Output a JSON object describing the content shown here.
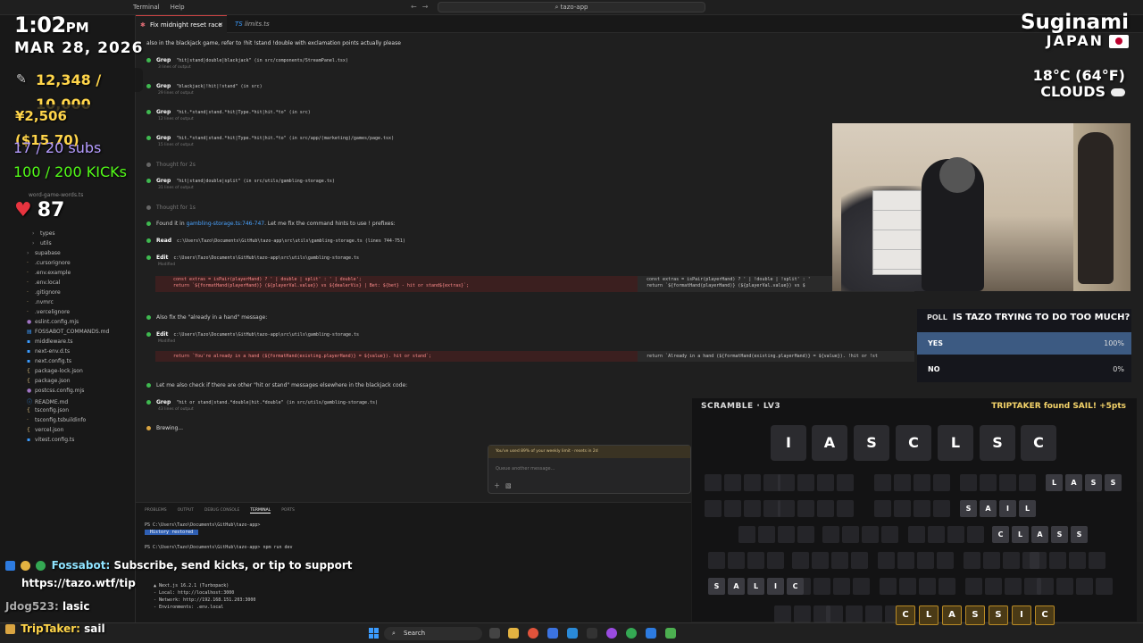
{
  "window": {
    "menu": [
      "Terminal",
      "Help"
    ],
    "search_text": "tazo-app"
  },
  "tabs": [
    {
      "label": "Fix midnight reset race ...",
      "active": true
    },
    {
      "label": "limits.ts",
      "active": false
    }
  ],
  "sidebar": {
    "items": [
      "types",
      "utils",
      "supabase",
      ".cursorignore",
      ".env.example",
      ".env.local",
      ".gitignore",
      ".nvmrc",
      ".vercelignore",
      "eslint.config.mjs",
      "FOSSABOT_COMMANDS.md",
      "middleware.ts",
      "next-env.d.ts",
      "next.config.ts",
      "package-lock.json",
      "package.json",
      "postcss.config.mjs",
      "README.md",
      "tsconfig.json",
      "tsconfig.tsbuildinfo",
      "vercel.json",
      "vitest.config.ts"
    ],
    "partial": "word-game-words.ts"
  },
  "chat": {
    "prompt": "also in the blackjack game, refer to !hit !stand !double with exclamation points actually please",
    "steps": [
      {
        "kw": "Grep",
        "cmd": "\"hit|stand|double|blackjack\"  (in src/components/StreamPanel.tsx)",
        "sub": "3 lines of output"
      },
      {
        "kw": "Grep",
        "cmd": "\"blackjack|!hit|!stand\"  (in src)",
        "sub": "29 lines of output"
      },
      {
        "kw": "Grep",
        "cmd": "\"hit.*stand|stand.*hit|Type.*hit|hit.*to\"  (in src)",
        "sub": "12 lines of output"
      },
      {
        "kw": "Grep",
        "cmd": "\"hit.*stand|stand.*hit|Type.*hit|hit.*to\"  (in src/app/(marketing)/games/page.tsx)",
        "sub": "15 lines of output"
      },
      {
        "kw": "",
        "cmd": "Thought for 2s",
        "sub": ""
      },
      {
        "kw": "Grep",
        "cmd": "\"hit|stand|double|split\"  (in src/utils/gambling-storage.ts)",
        "sub": "31 lines of output"
      },
      {
        "kw": "",
        "cmd": "Thought for 1s",
        "sub": ""
      }
    ],
    "found_text": "Found it in",
    "found_link": "gambling-storage.ts:746-747",
    "found_rest": ". Let me fix the command hints to use  !  prefixes:",
    "read": {
      "kw": "Read",
      "cmd": "c:\\Users\\Tazo\\Documents\\GitHub\\tazo-app\\src\\utils\\gambling-storage.ts (lines 744-751)"
    },
    "edit1": {
      "kw": "Edit",
      "cmd": "c:\\Users\\Tazo\\Documents\\GitHub\\tazo-app\\src\\utils\\gambling-storage.ts",
      "sub": "Modified"
    },
    "diff1": {
      "l1": "const extras = isPair(playerHand) ? ' | double | split' : ' | double';",
      "l2": "return `${formatHand(playerHand)} (${playerVal.value}) vs ${dealerVis} | Bet: ${bet} - hit or stand${extras}`;",
      "r1": "const extras = isPair(playerHand) ? ' | !double | !split' : '",
      "r2": "return `${formatHand(playerHand)} (${playerVal.value}) vs $"
    },
    "also_fix": "Also fix the \"already in a hand\" message:",
    "edit2": {
      "kw": "Edit",
      "cmd": "c:\\Users\\Tazo\\Documents\\GitHub\\tazo-app\\src\\utils\\gambling-storage.ts",
      "sub": "Modified"
    },
    "diff2": {
      "l1": "return `You're already in a hand (${formatHand(existing.playerHand)} = ${value}). hit or stand`;",
      "r1": "return `Already in a hand (${formatHand(existing.playerHand)} = ${value}). !hit or !st"
    },
    "check_text": "Let me also check if there are other \"hit or stand\" messages elsewhere in the blackjack code:",
    "grep_last": {
      "kw": "Grep",
      "cmd": "\"hit or stand|stand.*double|hit.*double\"  (in src/utils/gambling-storage.ts)",
      "sub": "43 lines of output"
    },
    "brewing": "Brewing..."
  },
  "input": {
    "warning": "You've used 89% of your weekly limit · resets in 2d",
    "placeholder": "Queue another message..."
  },
  "terminal": {
    "tabs": [
      "PROBLEMS",
      "OUTPUT",
      "DEBUG CONSOLE",
      "TERMINAL",
      "PORTS"
    ],
    "active_tab": "TERMINAL",
    "lines": [
      "PS C:\\Users\\Tazo\\Documents\\GitHub\\tazo-app>",
      "History restored",
      "PS C:\\Users\\Tazo\\Documents\\GitHub\\tazo-app> npm run dev",
      "▲ Next.js 16.2.1 (Turbopack)",
      "- Local:        http://localhost:3000",
      "- Network:      http://192.168.151.203:3000",
      "- Environments: .env.local"
    ]
  },
  "taskbar": {
    "search": "Search"
  },
  "overlay": {
    "time": "1:02",
    "ampm": "PM",
    "date": "MAR 28, 2026",
    "goal": "12,348 / 10,000",
    "yen": "¥2,506 ($15.70)",
    "subs": "17 / 20 subs",
    "kicks": "100 / 200 KICKs",
    "hearts": "87",
    "city": "Suginami",
    "country": "JAPAN",
    "weather_temp": "18°C (64°F)",
    "weather_cond": "CLOUDS"
  },
  "poll": {
    "tag": "POLL",
    "question": "IS TAZO TRYING TO DO TOO MUCH?",
    "options": [
      {
        "label": "YES",
        "pct": "100%",
        "value": 1.0
      },
      {
        "label": "NO",
        "pct": "0%",
        "value": 0.0
      }
    ]
  },
  "scramble": {
    "title": "SCRAMBLE · LV3",
    "found": "TRIPTAKER found SAIL! +5pts",
    "letters": [
      "I",
      "A",
      "S",
      "C",
      "L",
      "S",
      "C"
    ],
    "words": {
      "lass": [
        "L",
        "A",
        "S",
        "S"
      ],
      "sail": [
        "S",
        "A",
        "I",
        "L"
      ],
      "class": [
        "C",
        "L",
        "A",
        "S",
        "S"
      ],
      "salic": [
        "S",
        "A",
        "L",
        "I",
        "C"
      ],
      "classic": [
        "C",
        "L",
        "A",
        "S",
        "S",
        "I",
        "C"
      ]
    }
  },
  "chat_overlay": {
    "bot_name": "Fossabot:",
    "bot_msg": "Subscribe, send kicks, or tip to support",
    "bot_link": "https://tazo.wtf/tip",
    "user1": "Jdog523:",
    "user1_msg": "lasic",
    "user2": "TripTaker:",
    "user2_msg": "sail"
  }
}
